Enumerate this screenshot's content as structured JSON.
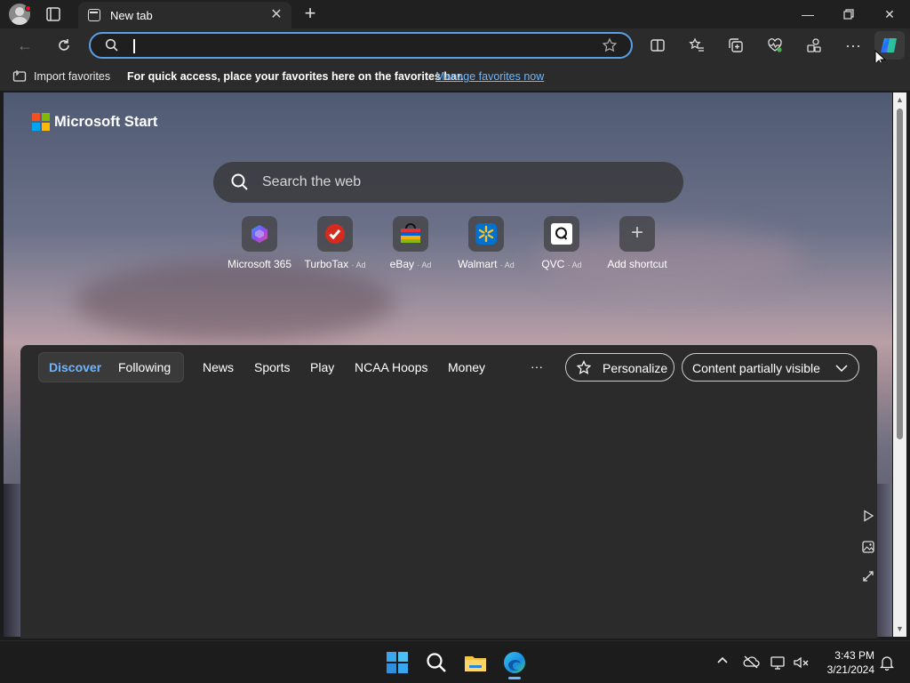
{
  "browser": {
    "tab_title": "New tab",
    "address_placeholder": "",
    "favorites_bar": {
      "import_label": "Import favorites",
      "message": "For quick access, place your favorites here on the favorites bar.",
      "manage_link": "Manage favorites now"
    }
  },
  "newtab": {
    "brand": "Microsoft Start",
    "search_placeholder": "Search the web",
    "shortcuts": [
      {
        "label": "Microsoft 365",
        "ad": "",
        "icon": "microsoft365-icon",
        "color": "#6b4fd8"
      },
      {
        "label": "TurboTax",
        "ad": "· Ad",
        "icon": "turbotax-icon",
        "color": "#d52b1e"
      },
      {
        "label": "eBay",
        "ad": "· Ad",
        "icon": "ebay-icon",
        "color": "#2a2a2a"
      },
      {
        "label": "Walmart",
        "ad": "· Ad",
        "icon": "walmart-icon",
        "color": "#0071ce"
      },
      {
        "label": "QVC",
        "ad": "· Ad",
        "icon": "qvc-icon",
        "color": "#ffffff"
      },
      {
        "label": "Add shortcut",
        "ad": "",
        "icon": "plus-icon",
        "color": "#555555"
      }
    ]
  },
  "feed": {
    "tabs": [
      "Discover",
      "Following"
    ],
    "nav": [
      "News",
      "Sports",
      "Play",
      "NCAA Hoops",
      "Money"
    ],
    "more": "···",
    "personalize": "Personalize",
    "content_visibility": "Content partially visible",
    "accent": "#6cb6ff"
  },
  "taskbar": {
    "time": "3:43 PM",
    "date": "3/21/2024"
  }
}
